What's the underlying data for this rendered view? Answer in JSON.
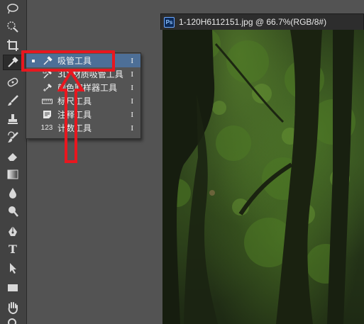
{
  "document": {
    "ps_badge": "Ps",
    "tab_title": "1-120H6112151.jpg @ 66.7%(RGB/8#)"
  },
  "toolbar": {
    "tools": [
      "lasso-tool",
      "quick-selection-tool",
      "crop-tool",
      "eyedropper-tool",
      "spot-healing-brush-tool",
      "brush-tool",
      "clone-stamp-tool",
      "history-brush-tool",
      "eraser-tool",
      "gradient-tool",
      "blur-tool",
      "dodge-tool",
      "pen-tool",
      "type-tool",
      "path-selection-tool",
      "rectangle-tool",
      "hand-tool",
      "zoom-tool"
    ],
    "type_tool_glyph": "T",
    "active_tool": "eyedropper-tool"
  },
  "flyout": {
    "items": [
      {
        "label": "吸管工具",
        "shortcut": "I",
        "icon": "eyedropper-icon",
        "selected": true
      },
      {
        "label": "3D 材质吸管工具",
        "shortcut": "I",
        "icon": "3d-material-eyedropper-icon",
        "selected": false
      },
      {
        "label": "颜色取样器工具",
        "shortcut": "I",
        "icon": "color-sampler-icon",
        "selected": false
      },
      {
        "label": "标尺工具",
        "shortcut": "I",
        "icon": "ruler-icon",
        "selected": false
      },
      {
        "label": "注释工具",
        "shortcut": "I",
        "icon": "note-icon",
        "selected": false
      },
      {
        "label": "计数工具",
        "shortcut": "I",
        "icon": "count-icon",
        "selected": false
      }
    ],
    "count_icon_text": "123"
  },
  "colors": {
    "annotation_red": "#e8171f",
    "menu_highlight": "#4d6f97",
    "panel_bg": "#424242"
  }
}
